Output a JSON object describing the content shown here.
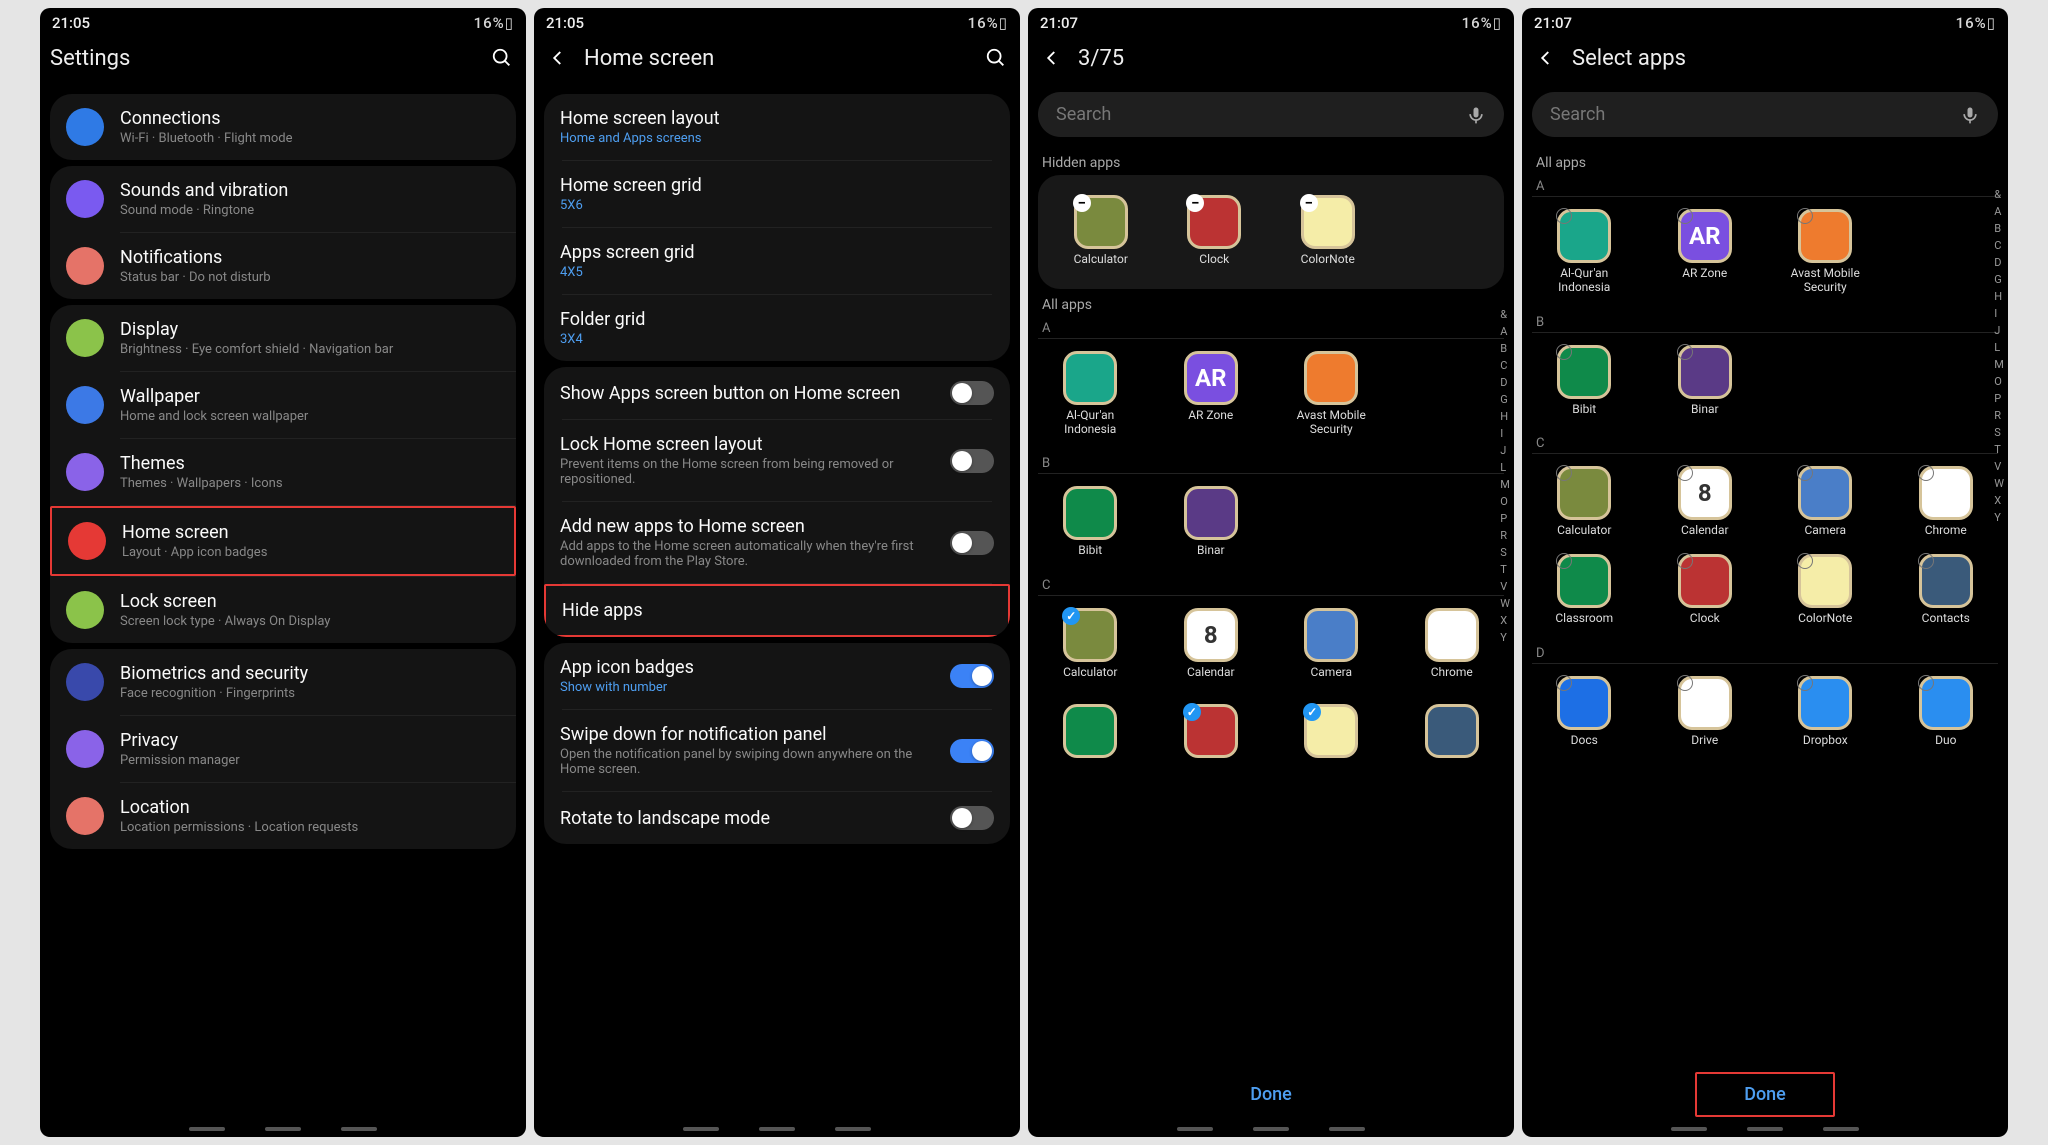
{
  "status": {
    "time1": "21:05",
    "time2": "21:05",
    "time3": "21:07",
    "time4": "21:07",
    "battery": "16%",
    "icons_left": "ᐯ ⬇ ◉ •",
    "icons_right": "⏰ ◢ 📶 ▁▃▅ ▯"
  },
  "s1": {
    "title": "Settings",
    "items": [
      {
        "title": "Connections",
        "sub": "Wi-Fi · Bluetooth · Flight mode",
        "icon": "wifi",
        "color": "ic-blue"
      },
      {
        "title": "Sounds and vibration",
        "sub": "Sound mode · Ringtone",
        "icon": "sound",
        "color": "ic-purple"
      },
      {
        "title": "Notifications",
        "sub": "Status bar · Do not disturb",
        "icon": "bell",
        "color": "ic-peach"
      },
      {
        "title": "Display",
        "sub": "Brightness · Eye comfort shield · Navigation bar",
        "icon": "sun",
        "color": "ic-green"
      },
      {
        "title": "Wallpaper",
        "sub": "Home and lock screen wallpaper",
        "icon": "image",
        "color": "ic-blue2"
      },
      {
        "title": "Themes",
        "sub": "Themes · Wallpapers · Icons",
        "icon": "palette",
        "color": "ic-violet"
      },
      {
        "title": "Home screen",
        "sub": "Layout · App icon badges",
        "icon": "home",
        "color": "ic-red",
        "hi": true
      },
      {
        "title": "Lock screen",
        "sub": "Screen lock type · Always On Display",
        "icon": "lock",
        "color": "ic-lime"
      },
      {
        "title": "Biometrics and security",
        "sub": "Face recognition · Fingerprints",
        "icon": "shield",
        "color": "ic-darkblue"
      },
      {
        "title": "Privacy",
        "sub": "Permission manager",
        "icon": "eye",
        "color": "ic-violet"
      },
      {
        "title": "Location",
        "sub": "Location permissions · Location requests",
        "icon": "pin",
        "color": "ic-peach"
      }
    ]
  },
  "s2": {
    "title": "Home screen",
    "g1": [
      {
        "title": "Home screen layout",
        "sub": "Home and Apps screens",
        "blue": true
      },
      {
        "title": "Home screen grid",
        "sub": "5X6",
        "blue": true
      },
      {
        "title": "Apps screen grid",
        "sub": "4X5",
        "blue": true
      },
      {
        "title": "Folder grid",
        "sub": "3X4",
        "blue": true
      }
    ],
    "g2": [
      {
        "title": "Show Apps screen button on Home screen",
        "toggle": true,
        "on": false
      },
      {
        "title": "Lock Home screen layout",
        "sub": "Prevent items on the Home screen from being removed or repositioned.",
        "toggle": true,
        "on": false
      },
      {
        "title": "Add new apps to Home screen",
        "sub": "Add apps to the Home screen automatically when they're first downloaded from the Play Store.",
        "toggle": true,
        "on": false
      },
      {
        "title": "Hide apps",
        "hi": true
      }
    ],
    "g3": [
      {
        "title": "App icon badges",
        "sub": "Show with number",
        "blue": true,
        "toggle": true,
        "on": true
      },
      {
        "title": "Swipe down for notification panel",
        "sub": "Open the notification panel by swiping down anywhere on the Home screen.",
        "toggle": true,
        "on": true
      },
      {
        "title": "Rotate to landscape mode",
        "toggle": true,
        "on": false
      }
    ]
  },
  "s3": {
    "title": "3/75",
    "search_ph": "Search",
    "hidden_label": "Hidden apps",
    "hidden": [
      {
        "label": "Calculator",
        "cls": "bg-olive",
        "hi": true
      },
      {
        "label": "Clock",
        "cls": "bg-red"
      },
      {
        "label": "ColorNote",
        "cls": "bg-paper"
      }
    ],
    "allapps_label": "All apps",
    "sections": [
      {
        "letter": "A",
        "apps": [
          {
            "label": "Al-Qur'an Indonesia",
            "cls": "bg-teal"
          },
          {
            "label": "AR Zone",
            "cls": "bg-purple",
            "txt": "AR"
          },
          {
            "label": "Avast Mobile Security",
            "cls": "bg-orange"
          }
        ]
      },
      {
        "letter": "B",
        "apps": [
          {
            "label": "Bibit",
            "cls": "bg-green"
          },
          {
            "label": "Binar",
            "cls": "bg-deep"
          }
        ]
      },
      {
        "letter": "C",
        "apps": [
          {
            "label": "Calculator",
            "cls": "bg-olive",
            "checked": true
          },
          {
            "label": "Calendar",
            "cls": "bg-white",
            "txt": "8"
          },
          {
            "label": "Camera",
            "cls": "bg-blue"
          },
          {
            "label": "Chrome",
            "cls": "bg-white"
          }
        ]
      },
      {
        "letter": "",
        "apps": [
          {
            "label": "",
            "cls": "bg-green"
          },
          {
            "label": "",
            "cls": "bg-red",
            "checked": true
          },
          {
            "label": "",
            "cls": "bg-paper",
            "checked": true
          },
          {
            "label": "",
            "cls": "bg-hat"
          }
        ]
      }
    ],
    "index": [
      "&",
      "A",
      "B",
      "C",
      "D",
      "G",
      "H",
      "I",
      "J",
      "L",
      "M",
      "O",
      "P",
      "R",
      "S",
      "T",
      "V",
      "W",
      "X",
      "Y"
    ],
    "done": "Done"
  },
  "s4": {
    "title": "Select apps",
    "search_ph": "Search",
    "allapps_label": "All apps",
    "sections": [
      {
        "letter": "A",
        "apps": [
          {
            "label": "Al-Qur'an Indonesia",
            "cls": "bg-teal"
          },
          {
            "label": "AR Zone",
            "cls": "bg-purple",
            "txt": "AR"
          },
          {
            "label": "Avast Mobile Security",
            "cls": "bg-orange"
          }
        ]
      },
      {
        "letter": "B",
        "apps": [
          {
            "label": "Bibit",
            "cls": "bg-green"
          },
          {
            "label": "Binar",
            "cls": "bg-deep"
          }
        ]
      },
      {
        "letter": "C",
        "apps": [
          {
            "label": "Calculator",
            "cls": "bg-olive"
          },
          {
            "label": "Calendar",
            "cls": "bg-white",
            "txt": "8"
          },
          {
            "label": "Camera",
            "cls": "bg-blue"
          },
          {
            "label": "Chrome",
            "cls": "bg-white"
          },
          {
            "label": "Classroom",
            "cls": "bg-green"
          },
          {
            "label": "Clock",
            "cls": "bg-red"
          },
          {
            "label": "ColorNote",
            "cls": "bg-paper"
          },
          {
            "label": "Contacts",
            "cls": "bg-hat"
          }
        ]
      },
      {
        "letter": "D",
        "apps": [
          {
            "label": "Docs",
            "cls": "bg-doc"
          },
          {
            "label": "Drive",
            "cls": "bg-drive"
          },
          {
            "label": "Dropbox",
            "cls": "bg-dbx"
          },
          {
            "label": "Duo",
            "cls": "bg-duo"
          }
        ]
      }
    ],
    "index": [
      "&",
      "A",
      "B",
      "C",
      "D",
      "G",
      "H",
      "I",
      "J",
      "L",
      "M",
      "O",
      "P",
      "R",
      "S",
      "T",
      "V",
      "W",
      "X",
      "Y"
    ],
    "done": "Done"
  }
}
